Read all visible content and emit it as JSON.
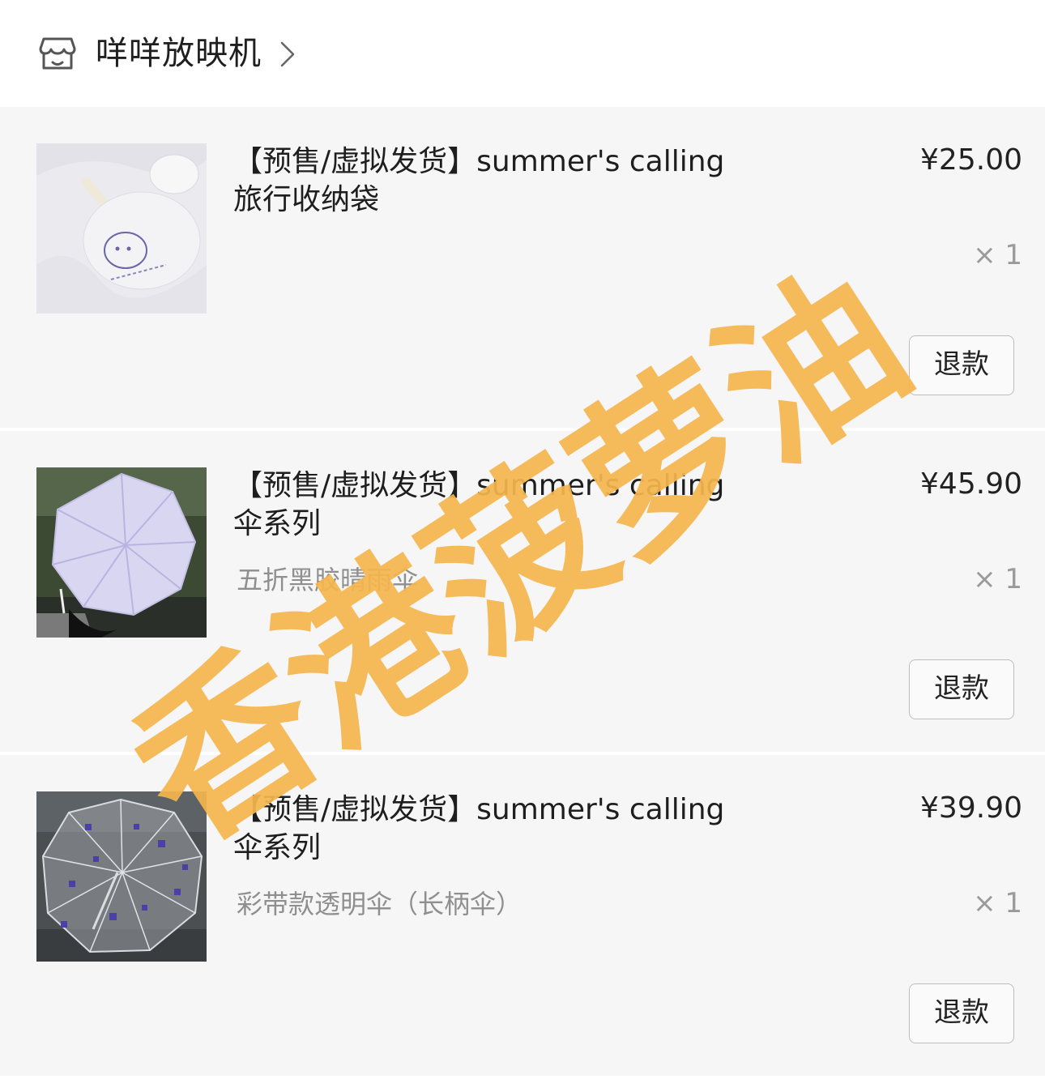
{
  "shop": {
    "name": "咩咩放映机",
    "icon": "store-icon"
  },
  "items": [
    {
      "title_line1": "【预售/虚拟发货】summer's calling",
      "title_line2": "旅行收纳袋",
      "variant": "",
      "price": "¥25.00",
      "qty": "× 1",
      "refund": "退款"
    },
    {
      "title_line1": "【预售/虚拟发货】summer's calling",
      "title_line2": "伞系列",
      "variant": "五折黑胶晴雨伞",
      "price": "¥45.90",
      "qty": "× 1",
      "refund": "退款"
    },
    {
      "title_line1": "【预售/虚拟发货】summer's calling",
      "title_line2": "伞系列",
      "variant": "彩带款透明伞（长柄伞）",
      "price": "¥39.90",
      "qty": "× 1",
      "refund": "退款"
    }
  ],
  "watermark": {
    "text": "香港菠萝油",
    "color": "#f4b54e"
  },
  "colors": {
    "page_bg": "#f6f6f6",
    "header_bg": "#ffffff",
    "muted": "#8f8f8f"
  }
}
